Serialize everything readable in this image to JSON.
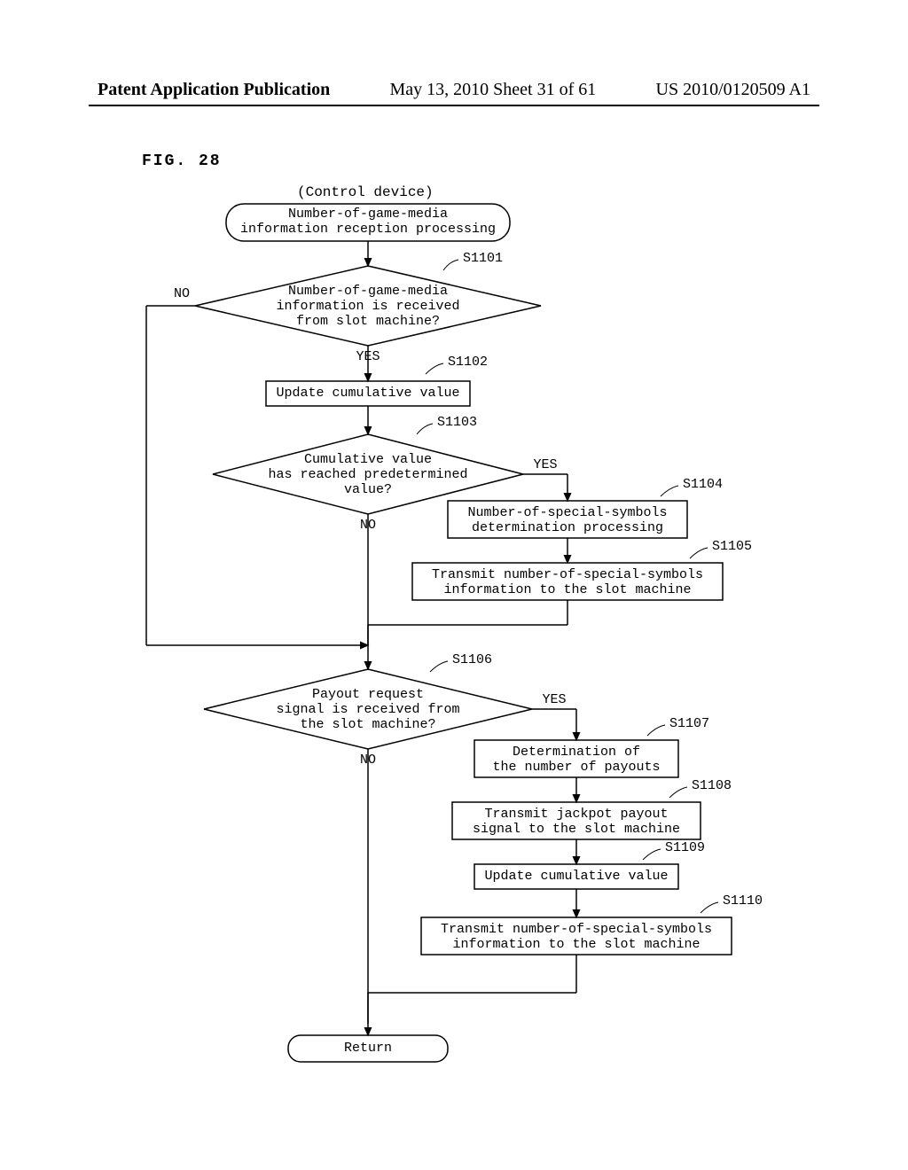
{
  "header": {
    "left": "Patent Application Publication",
    "mid": "May 13, 2010  Sheet 31 of 61",
    "right": "US 2010/0120509 A1"
  },
  "figure_label": "FIG. 28",
  "control_device": "(Control device)",
  "start": "Number-of-game-media\ninformation reception processing",
  "s1101": {
    "label": "S1101",
    "text": "Number-of-game-media\ninformation is received\nfrom slot machine?",
    "yes": "YES",
    "no": "NO"
  },
  "s1102": {
    "label": "S1102",
    "text": "Update cumulative value"
  },
  "s1103": {
    "label": "S1103",
    "text": "Cumulative value\nhas reached predetermined\nvalue?",
    "yes": "YES",
    "no": "NO"
  },
  "s1104": {
    "label": "S1104",
    "text": "Number-of-special-symbols\ndetermination processing"
  },
  "s1105": {
    "label": "S1105",
    "text": "Transmit number-of-special-symbols\ninformation to the slot machine"
  },
  "s1106": {
    "label": "S1106",
    "text": "Payout request\nsignal is received from\nthe slot machine?",
    "yes": "YES",
    "no": "NO"
  },
  "s1107": {
    "label": "S1107",
    "text": "Determination of\nthe number of payouts"
  },
  "s1108": {
    "label": "S1108",
    "text": "Transmit jackpot payout\nsignal to the slot machine"
  },
  "s1109": {
    "label": "S1109",
    "text": "Update cumulative value"
  },
  "s1110": {
    "label": "S1110",
    "text": "Transmit number-of-special-symbols\ninformation to the slot machine"
  },
  "return": "Return"
}
